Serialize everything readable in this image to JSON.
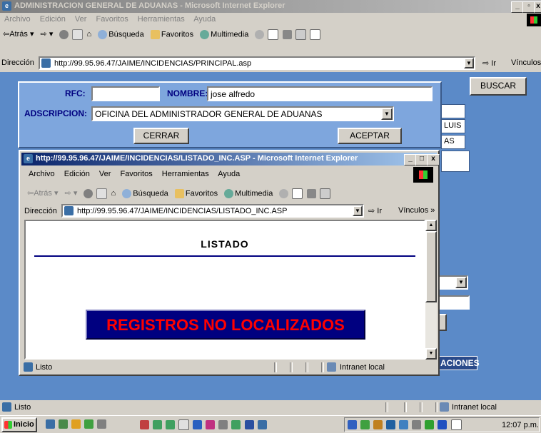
{
  "outer": {
    "title": "ADMINISTRACION GENERAL DE ADUANAS - Microsoft Internet Explorer",
    "menu": [
      "Archivo",
      "Edición",
      "Ver",
      "Favoritos",
      "Herramientas",
      "Ayuda"
    ],
    "toolbar": {
      "back": "Atrás",
      "search": "Búsqueda",
      "favorites": "Favoritos",
      "multimedia": "Multimedia"
    },
    "address_label": "Dirección",
    "url": "http://99.95.96.47/JAIME/INCIDENCIAS/PRINCIPAL.asp",
    "go": "Ir",
    "links": "Vínculos",
    "status": "Listo",
    "zone": "Intranet local"
  },
  "form": {
    "rfc_label": "RFC:",
    "rfc_value": "",
    "nombre_label": "NOMBRE:",
    "nombre_value": "jose alfredo",
    "adscripcion_label": "ADSCRIPCION:",
    "adscripcion_value": "OFICINA DEL ADMINISTRADOR GENERAL DE ADUANAS",
    "cerrar": "CERRAR",
    "aceptar": "ACEPTAR",
    "buscar": "BUSCAR",
    "bg_partial": [
      "LUIS",
      "AS"
    ],
    "acciones": "ACIONES"
  },
  "popup": {
    "title": "http://99.95.96.47/JAIME/INCIDENCIAS/LISTADO_INC.ASP - Microsoft Internet Explorer",
    "menu": [
      "Archivo",
      "Edición",
      "Ver",
      "Favoritos",
      "Herramientas",
      "Ayuda"
    ],
    "toolbar": {
      "back": "Atrás",
      "search": "Búsqueda",
      "favorites": "Favoritos",
      "multimedia": "Multimedia"
    },
    "address_label": "Dirección",
    "url": "http://99.95.96.47/JAIME/INCIDENCIAS/LISTADO_INC.ASP",
    "go": "Ir",
    "links": "Vínculos",
    "heading": "LISTADO",
    "message": "REGISTROS NO LOCALIZADOS",
    "status": "Listo",
    "zone": "Intranet local"
  },
  "taskbar": {
    "start": "Inicio",
    "clock": "12:07 p.m."
  },
  "colors": {
    "page_bg": "#5b8ac8",
    "panel": "#7ea6dd",
    "message_bg": "#000080",
    "message_text": "#ff0000",
    "title_active": "#0a246a"
  }
}
